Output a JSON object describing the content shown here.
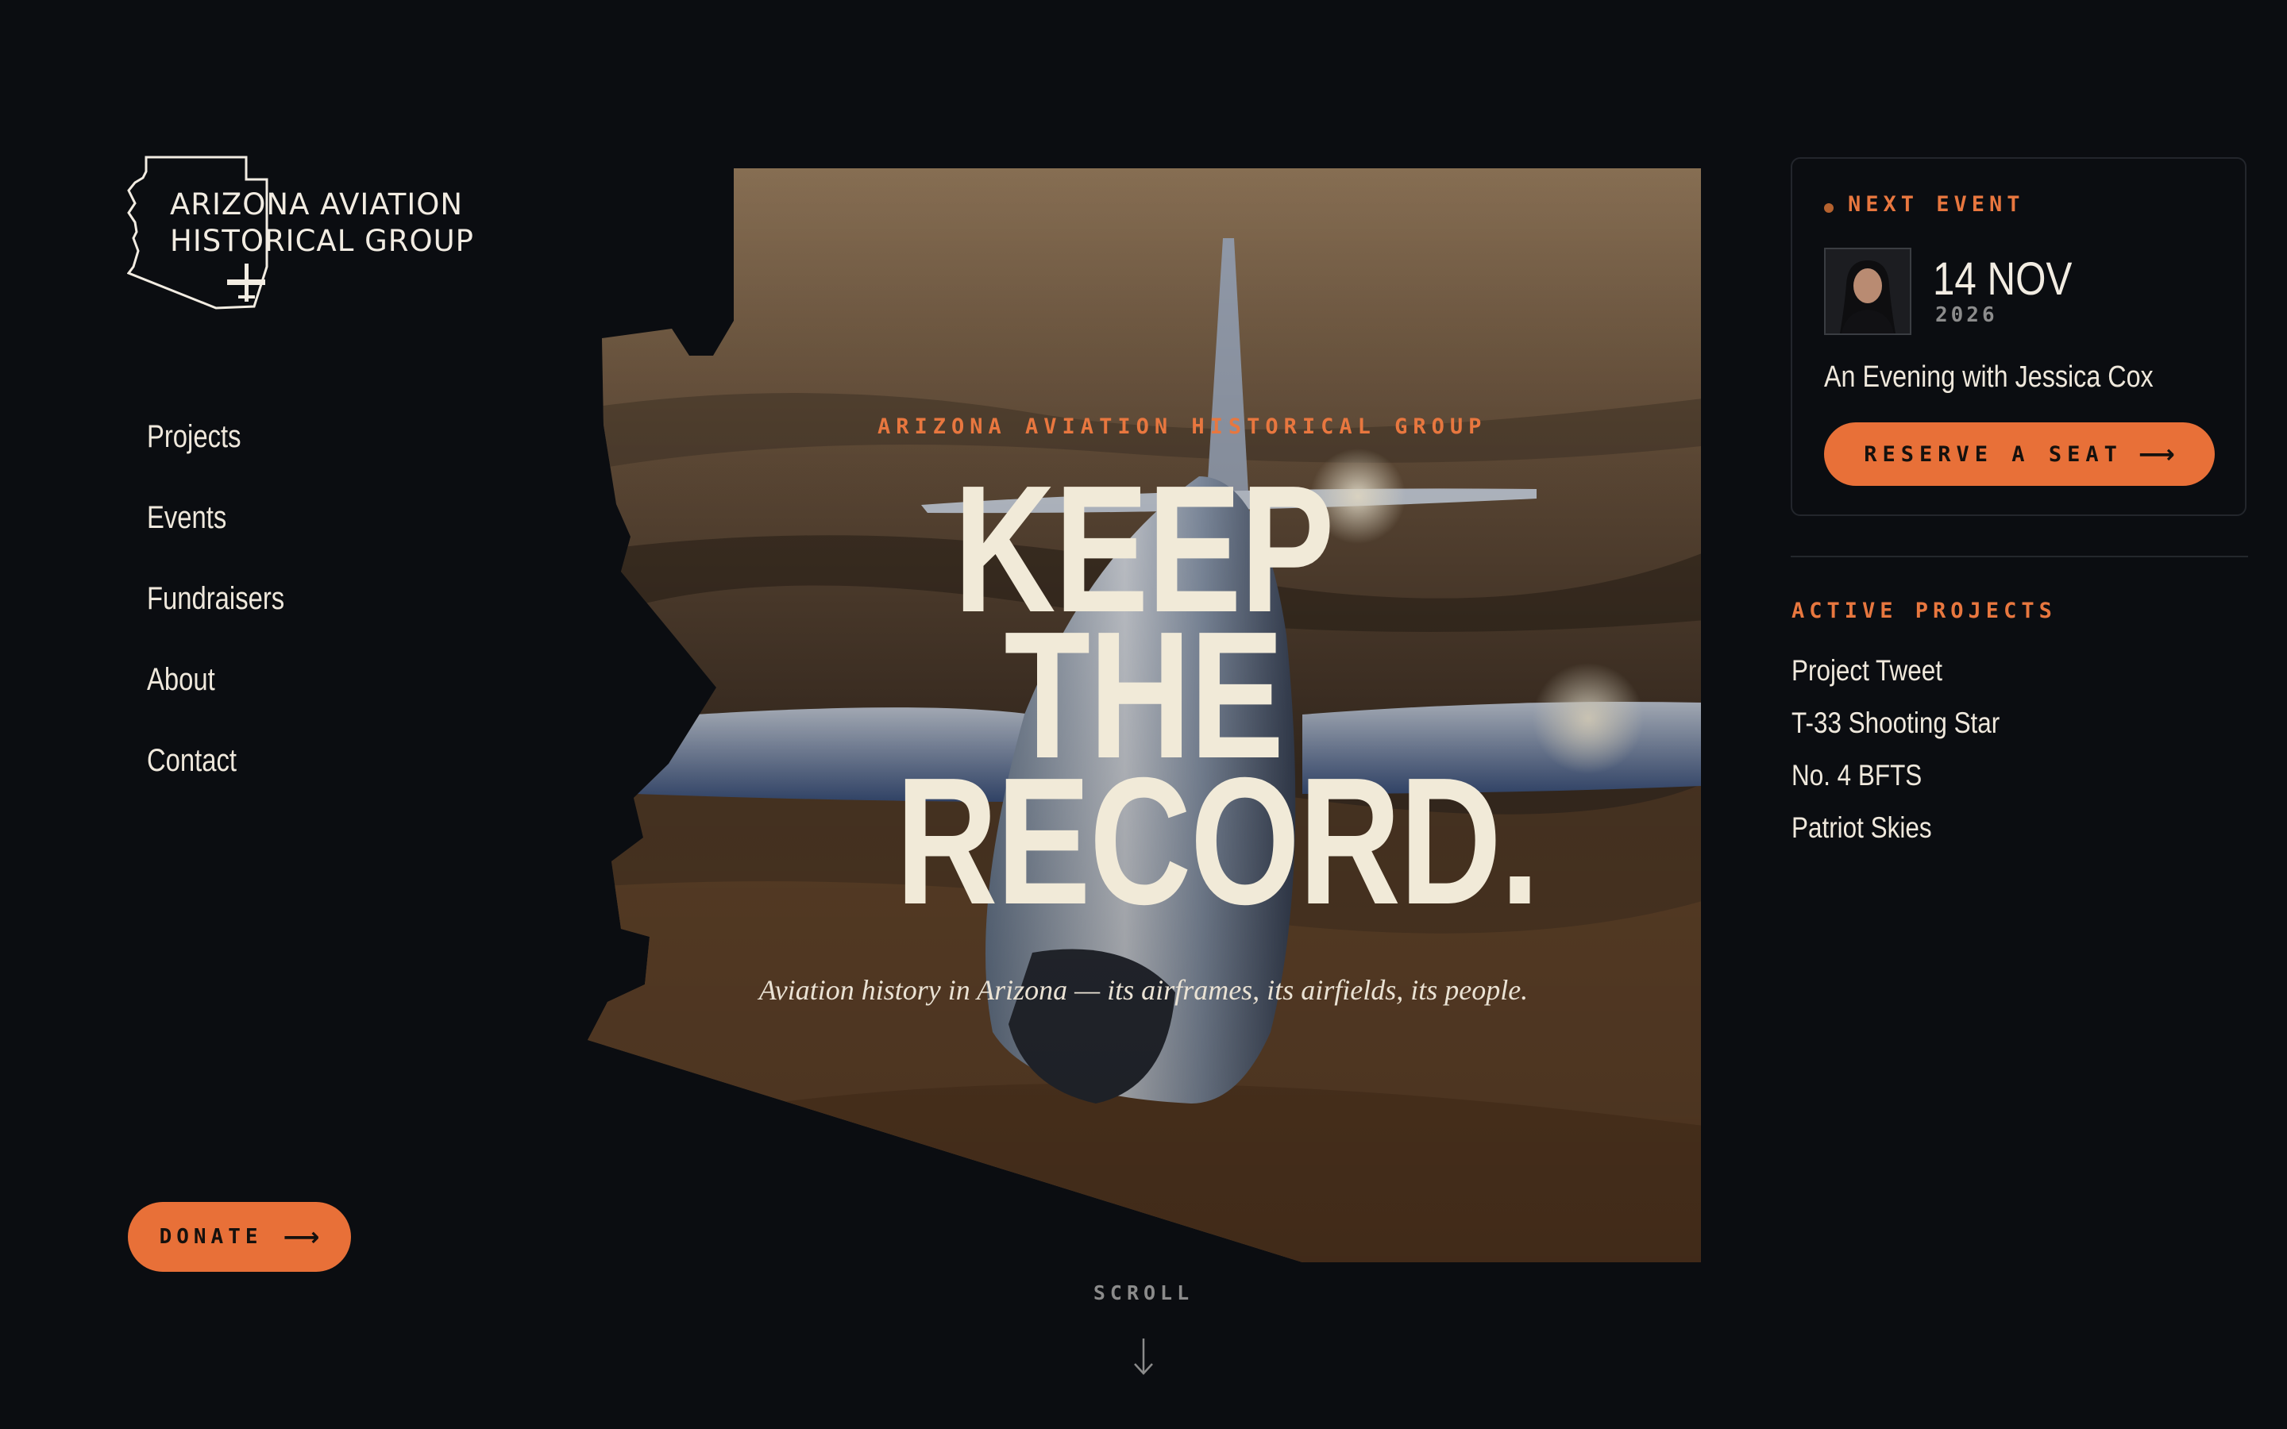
{
  "logo": {
    "line1": "ARIZONA AVIATION",
    "line2": "HISTORICAL GROUP",
    "icon": "arizona-outline-airplane-logo"
  },
  "nav": {
    "items": [
      {
        "label": "Projects"
      },
      {
        "label": "Events"
      },
      {
        "label": "Fundraisers"
      },
      {
        "label": "About"
      },
      {
        "label": "Contact"
      }
    ]
  },
  "donate": {
    "label": "DONATE",
    "icon": "arrow-right-icon"
  },
  "hero": {
    "kicker": "ARIZONA AVIATION HISTORICAL GROUP",
    "headline": [
      "KEEP",
      "THE",
      "RECORD."
    ],
    "tagline": "Aviation history in Arizona — its airframes, its airfields, its people.",
    "image": "jet-aircraft-over-desert-photo"
  },
  "scroll": {
    "label": "SCROLL",
    "icon": "arrow-down-icon"
  },
  "event": {
    "label": "NEXT EVENT",
    "date": "14 NOV",
    "year": "2026",
    "title": "An Evening with Jessica Cox",
    "button": "RESERVE A SEAT",
    "avatar": "speaker-portrait"
  },
  "projects": {
    "heading": "ACTIVE PROJECTS",
    "items": [
      {
        "label": "Project Tweet"
      },
      {
        "label": "T-33 Shooting Star"
      },
      {
        "label": "No. 4 BFTS"
      },
      {
        "label": "Patriot Skies"
      }
    ]
  },
  "colors": {
    "background": "#0b0d11",
    "accent": "#e87038",
    "text": "#efe8dc",
    "muted": "#8c8c8c"
  }
}
